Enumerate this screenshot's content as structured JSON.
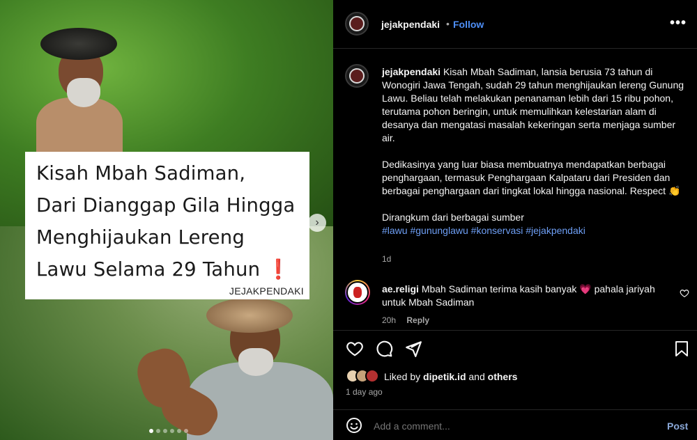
{
  "media": {
    "caption_lines": [
      "Kisah Mbah Sadiman,",
      "Dari Dianggap Gila Hingga",
      "Menghijaukan Lereng",
      "Lawu Selama 29 Tahun"
    ],
    "caption_mark": "❗",
    "credit": "JEJAKPENDAKI",
    "next_arrow": "›",
    "carousel_active_index": 0,
    "carousel_count": 6
  },
  "header": {
    "username": "jejakpendaki",
    "separator": "•",
    "follow_label": "Follow",
    "more_label": "•••"
  },
  "post": {
    "username": "jejakpendaki",
    "paragraph1": "Kisah Mbah Sadiman, lansia berusia 73 tahun di Wonogiri Jawa Tengah, sudah 29 tahun menghijaukan lereng Gunung Lawu. Beliau telah melakukan penanaman lebih dari 15 ribu pohon, terutama pohon beringin, untuk memulihkan kelestarian alam di desanya dan mengatasi masalah kekeringan serta menjaga sumber air.",
    "paragraph2": "Dedikasinya yang luar biasa membuatnya mendapatkan berbagai penghargaan, termasuk Penghargaan Kalpataru dari Presiden dan berbagai penghargaan dari tingkat lokal hingga nasional. Respect 👏",
    "paragraph3": "Dirangkum dari berbagai sumber",
    "hashtags": "#lawu #gununglawu #konservasi #jejakpendaki",
    "time": "1d"
  },
  "comment": {
    "username": "ae.religi",
    "text": "Mbah Sadiman terima kasih banyak 💗 pahala jariyah untuk Mbah Sadiman",
    "time": "20h",
    "reply_label": "Reply"
  },
  "likes": {
    "prefix": "Liked by",
    "user": "dipetik.id",
    "and": "and",
    "others": "others",
    "time": "1 day ago"
  },
  "comment_bar": {
    "placeholder": "Add a comment...",
    "post_label": "Post"
  },
  "colors": {
    "accent": "#4e8ff7",
    "hashtag": "#6e9ff5",
    "caption_mark": "#e02525"
  }
}
